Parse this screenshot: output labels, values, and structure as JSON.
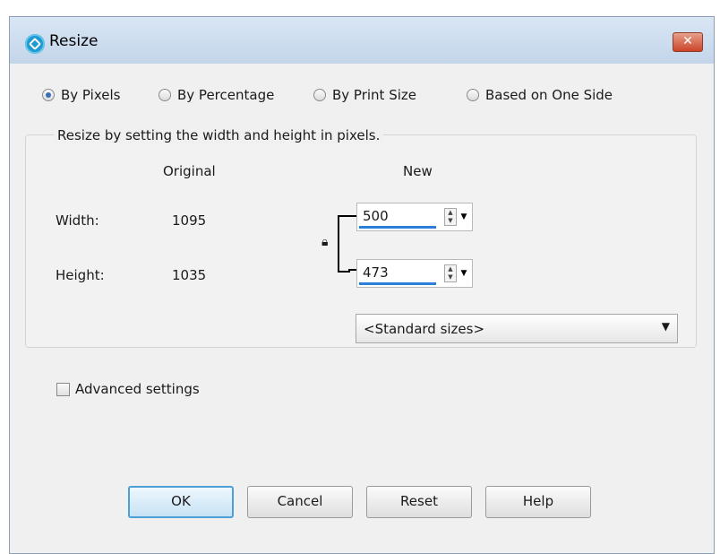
{
  "window": {
    "title": "Resize",
    "close_label": "✕"
  },
  "mode_options": [
    {
      "label": "By Pixels",
      "selected": true
    },
    {
      "label": "By Percentage",
      "selected": false
    },
    {
      "label": "By Print Size",
      "selected": false
    },
    {
      "label": "Based on One Side",
      "selected": false
    }
  ],
  "group": {
    "legend": "Resize by setting the width and height in pixels.",
    "original_header": "Original",
    "new_header": "New",
    "width_label": "Width:",
    "height_label": "Height:",
    "original_width": "1095",
    "original_height": "1035",
    "new_width": "500",
    "new_height": "473",
    "standard_sizes": "<Standard sizes>"
  },
  "advanced": {
    "label": "Advanced settings",
    "checked": false
  },
  "buttons": {
    "ok": "OK",
    "cancel": "Cancel",
    "reset": "Reset",
    "help": "Help"
  },
  "colors": {
    "accent": "#2a7fd8",
    "titlebar": "#c3d5ea",
    "close": "#c9452a"
  }
}
